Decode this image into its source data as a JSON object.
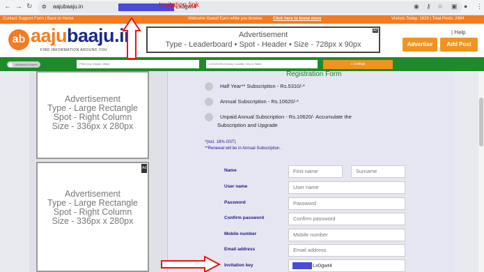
{
  "browser": {
    "url_start": "aajubaaju.in",
    "url_end": "Lx0gwt4",
    "annotation": "Invitation link"
  },
  "topbar": {
    "left": "Contact Support Form | Back to Home",
    "welcome": "Welcome Guest! Earn while you browse.",
    "link": "Click here to know more",
    "visitors": "Visitors Today: 1829 | Total Posts: 2684"
  },
  "header": {
    "logo_ab": "ab",
    "logo_a": "aaju",
    "logo_b": "baaju",
    "logo_c": ".in",
    "tagline": "FIND  INFORMATION  AROUND YOU",
    "ad_line1": "Advertisement",
    "ad_line2": "Type - Leaderboard • Spot - Header • Size - 728px x 90px",
    "ad_badge": "Ad",
    "help": "| Help",
    "advertise": "Advertise",
    "add_post": "Add Post"
  },
  "search": {
    "advanced": "Advanced Search",
    "find_placeholder": "FIND (e.g. biryani, dhtar)",
    "location_placeholder": "LOCATION (Colony, Locality, City or State)",
    "button": "Lookup"
  },
  "ads": {
    "box1": [
      "Advertisement",
      "Type - Large Rectangle",
      "Spot - Right Column",
      "Size - 336px x 280px"
    ],
    "box2": [
      "Advertisement",
      "Type - Large Rectangle",
      "Spot - Right Column",
      "Size - 336px x 280px"
    ],
    "badge": "Ad"
  },
  "registration": {
    "title": "Registration Form",
    "opt1": "Half Year** Subscription - Rs.5310/-*",
    "opt2": "Annual Subscription - Rs.10620/-*",
    "opt3a": "Unpaid Annual Subscription - Rs.10620/- Accumulate the",
    "opt3b": "Subscription and Upgrade",
    "gst": "*(incl. 18% GST)",
    "renewal": "**Renewal will be in Annual Subscription.",
    "name_label": "Name",
    "first_ph": "First name",
    "surname_ph": "Surname",
    "username_label": "User name",
    "username_ph": "User name",
    "password_label": "Password",
    "password_ph": "Password",
    "confirm_label": "Confirm password",
    "confirm_ph": "Confirm password",
    "mobile_label": "Mobile number",
    "mobile_ph": "Mobile number",
    "email_label": "Email address",
    "email_ph": "Email address",
    "invite_label": "Invitation key",
    "invite_value": "Lx0gwt4"
  }
}
